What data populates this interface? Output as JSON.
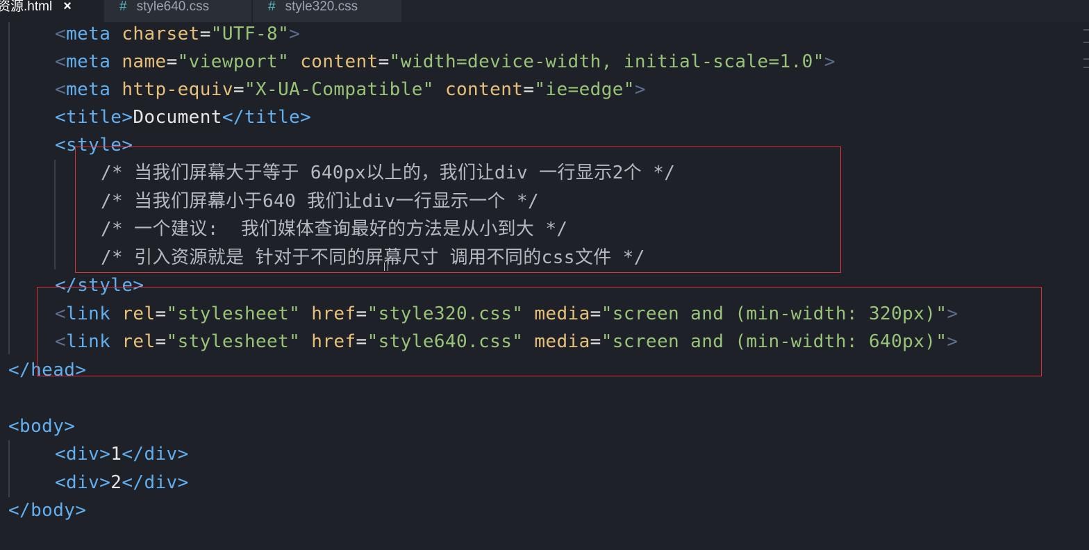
{
  "tabs": [
    {
      "label": "资源.html",
      "active": true,
      "close": "×"
    },
    {
      "label": "style640.css",
      "icon": "#"
    },
    {
      "label": "style320.css",
      "icon": "#"
    }
  ],
  "code": {
    "l1": {
      "lt": "<",
      "tag": "meta",
      "attr1": "charset",
      "eq": "=",
      "val1": "\"UTF-8\"",
      "gt": ">"
    },
    "l2": {
      "lt": "<",
      "tag": "meta",
      "attr1": "name",
      "val1": "\"viewport\"",
      "attr2": "content",
      "val2": "\"width=device-width, initial-scale=1.0\"",
      "gt": ">"
    },
    "l3": {
      "lt": "<",
      "tag": "meta",
      "attr1": "http-equiv",
      "val1": "\"X-UA-Compatible\"",
      "attr2": "content",
      "val2": "\"ie=edge\"",
      "gt": ">"
    },
    "l4": {
      "open": "<title>",
      "text": "Document",
      "close": "</title>"
    },
    "l5": {
      "open": "<style>"
    },
    "comments": [
      "/* 当我们屏幕大于等于 640px以上的，我们让div 一行显示2个 */",
      "/* 当我们屏幕小于640 我们让div一行显示一个 */",
      "/* 一个建议:  我们媒体查询最好的方法是从小到大 */",
      "/* 引入资源就是 针对于不同的屏幕尺寸 调用不同的css文件 */"
    ],
    "l10": {
      "close": "</style>"
    },
    "l11": {
      "lt": "<",
      "tag": "link",
      "attr1": "rel",
      "val1": "\"stylesheet\"",
      "attr2": "href",
      "val2": "\"style320.css\"",
      "attr3": "media",
      "val3": "\"screen and (min-width: 320px)\"",
      "gt": ">"
    },
    "l12": {
      "lt": "<",
      "tag": "link",
      "attr1": "rel",
      "val1": "\"stylesheet\"",
      "attr2": "href",
      "val2": "\"style640.css\"",
      "attr3": "media",
      "val3": "\"screen and (min-width: 640px)\"",
      "gt": ">"
    },
    "l13": {
      "close": "</head>"
    },
    "l15": {
      "open": "<body>"
    },
    "l16": {
      "open": "<div>",
      "text": "1",
      "close": "</div>"
    },
    "l17": {
      "open": "<div>",
      "text": "2",
      "close": "</div>"
    },
    "l18": {
      "close": "</body>"
    }
  },
  "colors": {
    "annotation_box": "#e0303a",
    "tag": "#61afef",
    "attribute": "#e5c07b",
    "string": "#98c379"
  }
}
